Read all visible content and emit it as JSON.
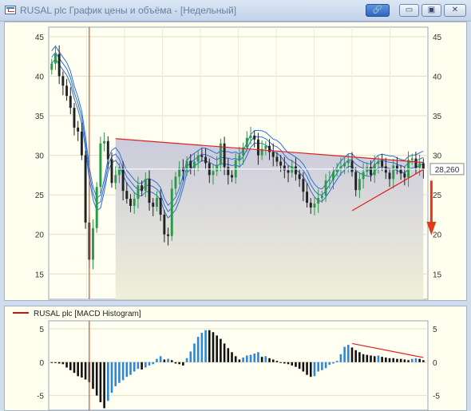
{
  "window": {
    "title": "RUSAL plc График цены и объёма - [Недельный]",
    "buttons": {
      "link": "🔗",
      "minimize": "▭",
      "maximize": "▣",
      "close": "✕"
    }
  },
  "chart_data": [
    {
      "type": "candlestick",
      "title": "",
      "ylim": [
        11.8,
        46.2
      ],
      "y_ticks": [
        15,
        20,
        25,
        30,
        35,
        40,
        45
      ],
      "grid": true,
      "last_price_label": "28,260",
      "colors": {
        "up": "#2a9a4a",
        "down": "#222222",
        "bands": "#2f6fd6",
        "trend": "#e02020",
        "arrow": "#e03a1a",
        "area_top": "#c8c8dc",
        "area_bottom": "#efeed6"
      },
      "closes": [
        41.6,
        42.8,
        40.0,
        38.8,
        37.5,
        36.0,
        33.5,
        33.0,
        30.0,
        21.5,
        16.8,
        20.8,
        26.0,
        31.5,
        31.8,
        29.5,
        26.5,
        27.5,
        28.4,
        25.5,
        24.5,
        23.6,
        24.5,
        26.2,
        25.5,
        27.0,
        24.0,
        23.5,
        24.6,
        22.5,
        20.0,
        19.8,
        25.8,
        27.3,
        28.4,
        28.0,
        29.3,
        28.4,
        29.2,
        30.0,
        29.8,
        29.0,
        27.5,
        28.0,
        28.8,
        31.5,
        28.5,
        27.5,
        27.2,
        29.4,
        30.0,
        31.0,
        32.2,
        32.5,
        32.0,
        30.0,
        30.8,
        31.2,
        30.4,
        29.8,
        29.2,
        28.7,
        28.1,
        27.8,
        28.6,
        27.6,
        27.0,
        25.4,
        24.0,
        23.4,
        23.9,
        24.6,
        24.9,
        26.8,
        26.9,
        27.9,
        28.2,
        28.6,
        29.0,
        29.3,
        27.9,
        25.6,
        27.0,
        27.9,
        28.5,
        27.5,
        28.9,
        29.3,
        28.6,
        27.8,
        27.0,
        28.7,
        28.2,
        27.7,
        27.2,
        29.4,
        29.6,
        28.4,
        29.0,
        28.26
      ],
      "bands": {
        "offsets": [
          -0.8,
          0,
          0.8
        ],
        "note": "envelope around moving average"
      },
      "support_line": {
        "from": [
          80,
          23.0
        ],
        "to": [
          99,
          28.2
        ]
      },
      "resistance_line": {
        "from": [
          17,
          32.1
        ],
        "to": [
          99,
          29.1
        ]
      }
    },
    {
      "type": "bar",
      "title": "",
      "legend": "RUSAL plc [MACD Histogram]",
      "ylim": [
        -7.2,
        6.2
      ],
      "y_ticks": [
        -5,
        0,
        5
      ],
      "colors": {
        "positive_rising": "#2e86d8",
        "negative_rising": "#2e86d8",
        "falling": "#111111",
        "trend": "#e02020"
      },
      "values": [
        0.0,
        -0.1,
        -0.2,
        -0.3,
        -0.8,
        -1.2,
        -1.6,
        -2.1,
        -2.3,
        -2.6,
        -3.0,
        -4.0,
        -5.0,
        -6.0,
        -6.9,
        -5.8,
        -4.6,
        -3.6,
        -3.1,
        -2.7,
        -2.2,
        -1.9,
        -1.4,
        -1.0,
        -1.1,
        -0.8,
        -0.5,
        -0.3,
        0.5,
        0.9,
        0.4,
        0.5,
        0.3,
        -0.2,
        -0.3,
        -0.5,
        0.6,
        1.6,
        2.8,
        3.8,
        4.4,
        4.8,
        4.8,
        4.5,
        4.0,
        3.5,
        2.8,
        2.1,
        1.5,
        0.9,
        0.4,
        0.7,
        1.0,
        1.1,
        1.3,
        1.5,
        0.8,
        0.9,
        0.6,
        0.4,
        0.2,
        0.0,
        -0.2,
        -0.3,
        -0.5,
        -0.7,
        -1.0,
        -1.4,
        -1.9,
        -2.2,
        -2.1,
        -1.4,
        -1.2,
        -0.9,
        -0.4,
        -0.2,
        0.2,
        1.2,
        2.3,
        2.6,
        2.2,
        1.8,
        1.5,
        1.2,
        1.1,
        1.0,
        0.9,
        1.0,
        0.8,
        0.7,
        0.6,
        0.6,
        0.5,
        0.5,
        0.4,
        0.3,
        0.5,
        0.6,
        0.5,
        0.3
      ],
      "trend_line": {
        "from": [
          80,
          2.8
        ],
        "to": [
          99,
          0.7
        ]
      }
    }
  ]
}
